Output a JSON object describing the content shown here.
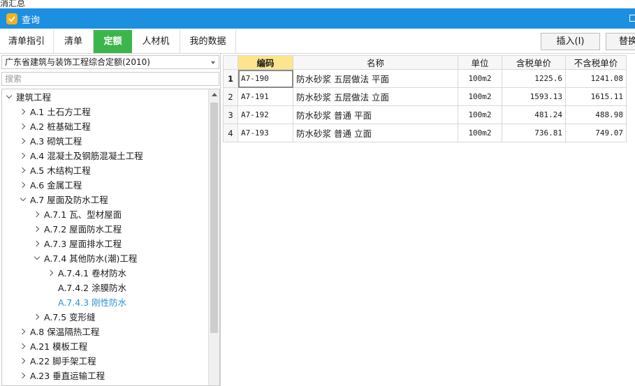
{
  "outer": {
    "partial_text": "消汇总"
  },
  "window": {
    "title": "查询"
  },
  "tabs": [
    {
      "label": "清单指引",
      "active": false
    },
    {
      "label": "清单",
      "active": false
    },
    {
      "label": "定额",
      "active": true
    },
    {
      "label": "人材机",
      "active": false
    },
    {
      "label": "我的数据",
      "active": false
    }
  ],
  "toolbar": {
    "insert_label": "插入(I)",
    "replace_label": "替换"
  },
  "left": {
    "library_selected": "广东省建筑与装饰工程综合定额(2010)",
    "search_placeholder": "搜索"
  },
  "tree": [
    {
      "label": "建筑工程",
      "level": 0,
      "state": "open"
    },
    {
      "label": "A.1 土石方工程",
      "level": 1,
      "state": "closed"
    },
    {
      "label": "A.2 桩基础工程",
      "level": 1,
      "state": "closed"
    },
    {
      "label": "A.3 砌筑工程",
      "level": 1,
      "state": "closed"
    },
    {
      "label": "A.4 混凝土及钢筋混凝土工程",
      "level": 1,
      "state": "closed"
    },
    {
      "label": "A.5 木结构工程",
      "level": 1,
      "state": "closed"
    },
    {
      "label": "A.6 金属工程",
      "level": 1,
      "state": "closed"
    },
    {
      "label": "A.7 屋面及防水工程",
      "level": 1,
      "state": "open"
    },
    {
      "label": "A.7.1 瓦、型材屋面",
      "level": 2,
      "state": "closed"
    },
    {
      "label": "A.7.2 屋面防水工程",
      "level": 2,
      "state": "closed"
    },
    {
      "label": "A.7.3 屋面排水工程",
      "level": 2,
      "state": "closed"
    },
    {
      "label": "A.7.4 其他防水(潮)工程",
      "level": 2,
      "state": "open"
    },
    {
      "label": "A.7.4.1 卷材防水",
      "level": 3,
      "state": "closed"
    },
    {
      "label": "A.7.4.2 涂膜防水",
      "level": 3,
      "state": "leaf"
    },
    {
      "label": "A.7.4.3 刚性防水",
      "level": 3,
      "state": "leaf",
      "selected": true
    },
    {
      "label": "A.7.5 变形缝",
      "level": 2,
      "state": "closed"
    },
    {
      "label": "A.8 保温隔热工程",
      "level": 1,
      "state": "closed"
    },
    {
      "label": "A.21 模板工程",
      "level": 1,
      "state": "closed"
    },
    {
      "label": "A.22 脚手架工程",
      "level": 1,
      "state": "closed"
    },
    {
      "label": "A.23 垂直运输工程",
      "level": 1,
      "state": "closed"
    }
  ],
  "table": {
    "columns": [
      "",
      "编码",
      "名称",
      "单位",
      "含税单价",
      "不含税单价"
    ],
    "rows": [
      {
        "idx": "1",
        "code": "A7-190",
        "name": "防水砂浆 五层做法 平面",
        "unit": "100m2",
        "tax_price": "1225.6",
        "notax_price": "1241.08"
      },
      {
        "idx": "2",
        "code": "A7-191",
        "name": "防水砂浆 五层做法 立面",
        "unit": "100m2",
        "tax_price": "1593.13",
        "notax_price": "1615.11"
      },
      {
        "idx": "3",
        "code": "A7-192",
        "name": "防水砂浆 普通 平面",
        "unit": "100m2",
        "tax_price": "481.24",
        "notax_price": "488.98"
      },
      {
        "idx": "4",
        "code": "A7-193",
        "name": "防水砂浆 普通 立面",
        "unit": "100m2",
        "tax_price": "736.81",
        "notax_price": "749.07"
      }
    ]
  },
  "colors": {
    "titlebar": "#1d8fe0",
    "active_tab": "#3cb64a",
    "selected_header": "#fde58c",
    "selected_node": "#2a93d5"
  }
}
